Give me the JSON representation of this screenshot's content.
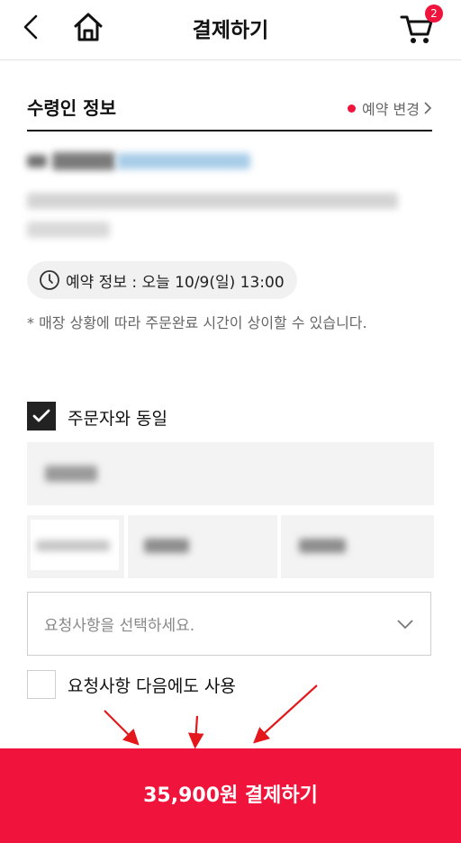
{
  "header": {
    "title": "결제하기",
    "cart_count": "2"
  },
  "recipient": {
    "section_title": "수령인 정보",
    "change_link": "예약 변경"
  },
  "reservation": {
    "info": "예약 정보 : 오늘 10/9(일) 13:00",
    "note": "* 매장 상황에 따라 주문완료 시간이 상이할 수 있습니다."
  },
  "same_as_orderer": {
    "label": "주문자와 동일",
    "checked": true
  },
  "request": {
    "placeholder": "요청사항을 선택하세요.",
    "reuse_label": "요청사항 다음에도 사용",
    "reuse_checked": false
  },
  "pay_button": {
    "label": "35,900원 결제하기"
  },
  "colors": {
    "accent": "#f0143c",
    "arrow": "#e4181c"
  }
}
